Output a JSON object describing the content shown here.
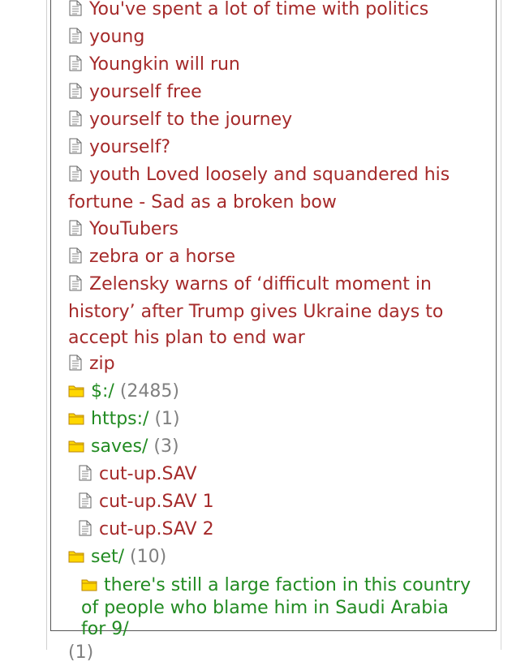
{
  "files_top": [
    "You've spent a lot of time with politics",
    "young",
    "Youngkin will run",
    "yourself free",
    "yourself to the journey",
    "yourself?",
    "youth Loved loosely and squandered his fortune - Sad as a broken bow",
    "YouTubers",
    "zebra or a horse",
    "Zelensky warns of ‘difficult moment in history’ after Trump gives Ukraine days to accept his plan to end war",
    "zip"
  ],
  "folders": [
    {
      "name": "$:/",
      "count": "(2485)"
    },
    {
      "name": "https:/",
      "count": "(1)"
    },
    {
      "name": "saves/",
      "count": "(3)"
    }
  ],
  "saves_files": [
    "cut-up.SAV",
    "cut-up.SAV 1",
    "cut-up.SAV 2"
  ],
  "set_folder": {
    "name": "set/",
    "count": "(10)"
  },
  "sub_folder": {
    "name": "there's still a large faction in this country of people who blame him in Saudi Arabia for 9/",
    "count": "(1)"
  }
}
